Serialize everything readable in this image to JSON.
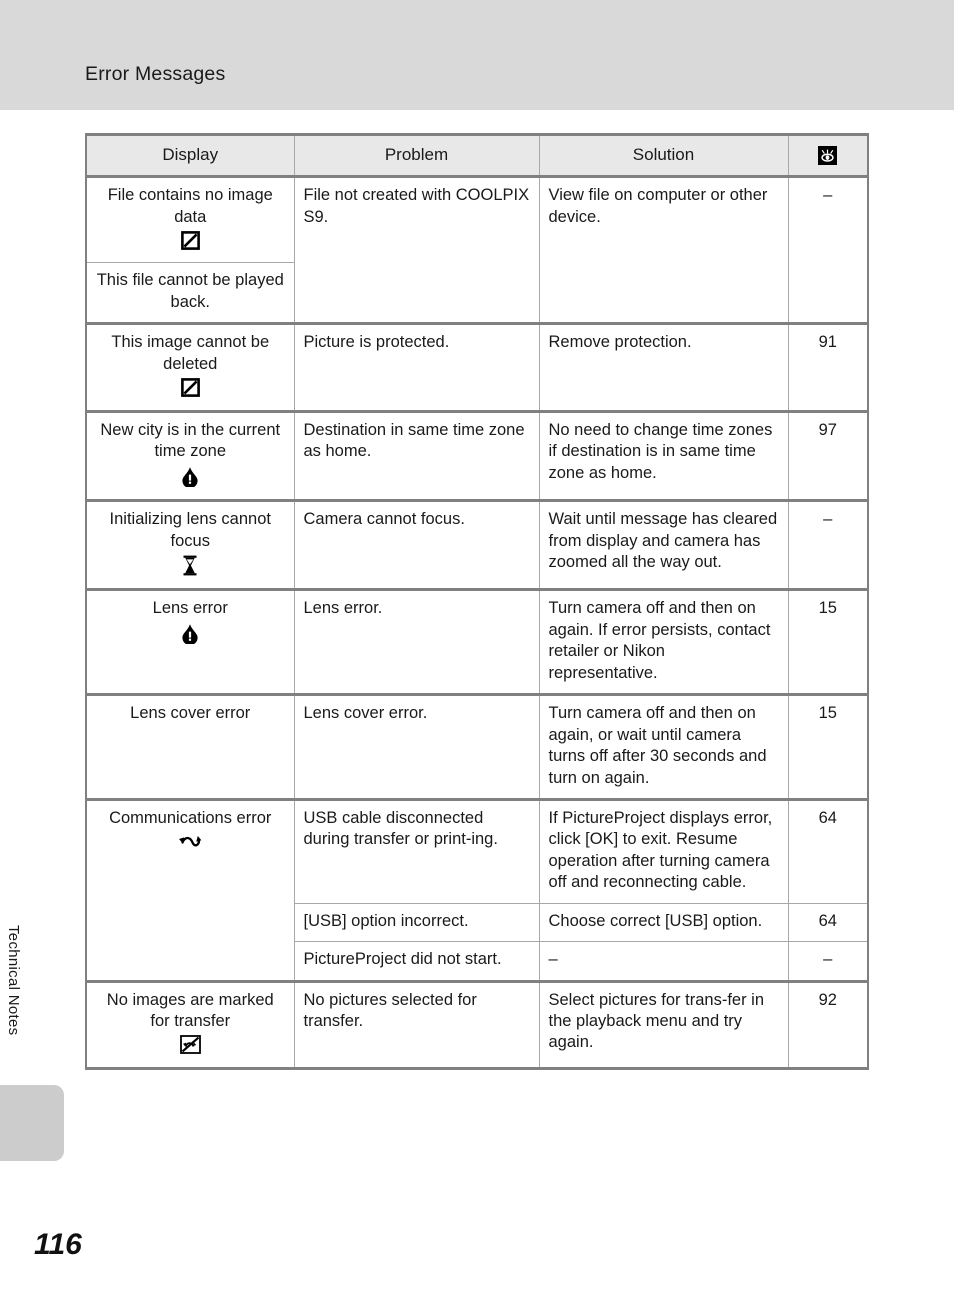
{
  "header": {
    "title": "Error Messages"
  },
  "side": {
    "section_label": "Technical Notes",
    "page_number": "116"
  },
  "table": {
    "columns": [
      {
        "key": "display",
        "label": "Display"
      },
      {
        "key": "problem",
        "label": "Problem"
      },
      {
        "key": "solution",
        "label": "Solution"
      },
      {
        "key": "page",
        "label": "",
        "icon": "reference-page-icon"
      }
    ],
    "rows": [
      {
        "display": "File contains no image data",
        "display_icon": "no-image-icon",
        "problem": "File not created with COOLPIX S9.",
        "solution": "View file on computer or other device.",
        "page": "–"
      },
      {
        "display": "This file cannot be played back.",
        "display_icon": "",
        "problem": "",
        "solution": "",
        "page": ""
      },
      {
        "display": "This image cannot be deleted",
        "display_icon": "no-image-icon",
        "problem": "Picture is protected.",
        "solution": "Remove protection.",
        "page": "91"
      },
      {
        "display": "New city is in the current time zone",
        "display_icon": "warning-icon",
        "problem": "Destination in same time zone as home.",
        "solution": "No need to change time zones if destination is in same time zone as home.",
        "page": "97"
      },
      {
        "display": "Initializing lens cannot focus",
        "display_icon": "hourglass-icon",
        "problem": "Camera cannot focus.",
        "solution": "Wait until message has cleared from display and camera has zoomed all the way out.",
        "page": "–"
      },
      {
        "display": "Lens error",
        "display_icon": "warning-icon",
        "problem": "Lens error.",
        "solution": "Turn camera off and then on again. If error persists, contact retailer or Nikon representative.",
        "page": "15"
      },
      {
        "display": "Lens cover error",
        "display_icon": "",
        "problem": "Lens cover error.",
        "solution": "Turn camera off and then on again, or wait until camera turns off after 30 seconds and turn on again.",
        "page": "15"
      },
      {
        "display": "Communications error",
        "display_icon": "transfer-icon",
        "problem": "USB cable disconnected during transfer or print-ing.",
        "solution": "If PictureProject displays error, click [OK] to exit. Resume operation after turning camera off and reconnecting cable.",
        "page": "64"
      },
      {
        "display": "",
        "display_icon": "",
        "problem": "[USB] option incorrect.",
        "solution": "Choose correct [USB] option.",
        "page": "64"
      },
      {
        "display": "",
        "display_icon": "",
        "problem": "PictureProject did not start.",
        "solution": "–",
        "page": "–"
      },
      {
        "display": "No images are marked for transfer",
        "display_icon": "no-transfer-icon",
        "problem": "No pictures selected for transfer.",
        "solution": "Select pictures for trans-fer in the playback menu and try again.",
        "page": "92"
      }
    ]
  }
}
